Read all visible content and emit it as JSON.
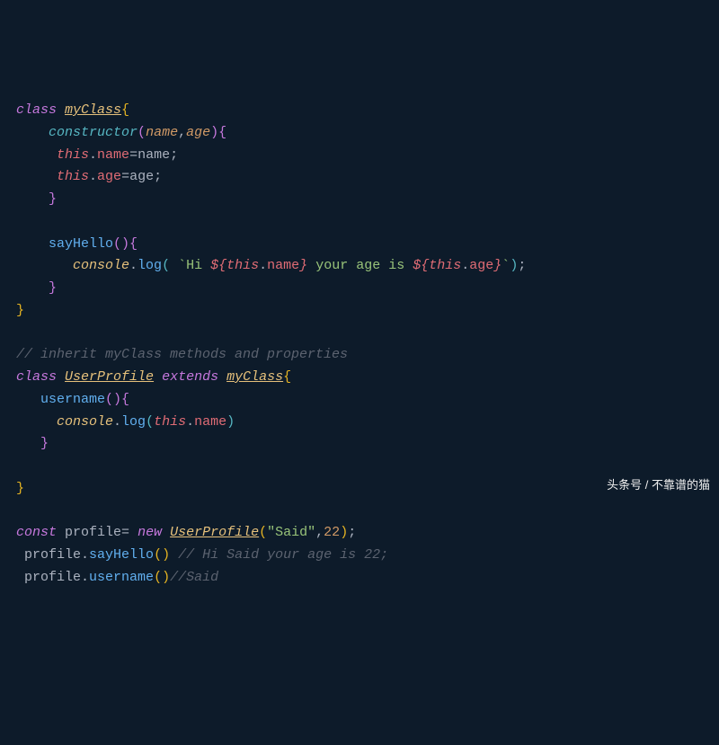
{
  "code": {
    "l1": {
      "class": "class",
      "name": "myClass",
      "ob": "{"
    },
    "l2": {
      "ctor": "constructor",
      "op": "(",
      "p1": "name",
      "c": ",",
      "p2": "age",
      "cp": ")",
      "ob": "{"
    },
    "l3": {
      "this": "this",
      "dot": ".",
      "prop": "name",
      "eq": "=",
      "val": "name",
      "sc": ";"
    },
    "l4": {
      "this": "this",
      "dot": ".",
      "prop": "age",
      "eq": "=",
      "val": "age",
      "sc": ";"
    },
    "l5": {
      "cb": "}"
    },
    "l7": {
      "meth": "sayHello",
      "par": "()",
      "ob": "{"
    },
    "l8": {
      "cons": "console",
      "dot": ".",
      "log": "log",
      "op": "(",
      "sp": " ",
      "bt1": "`Hi ",
      "d1": "${",
      "this1": "this",
      "dot1": ".",
      "prop1": "name",
      "cb1": "}",
      "mid": " your age is ",
      "d2": "${",
      "this2": "this",
      "dot2": ".",
      "prop2": "age",
      "cb2": "}",
      "bt2": "`",
      "cp": ")",
      "sc": ";"
    },
    "l9": {
      "cb": "}"
    },
    "l10": {
      "cb": "}"
    },
    "l12": {
      "cmt": "// inherit myClass methods and properties"
    },
    "l13": {
      "class": "class",
      "name": "UserProfile",
      "ext": "extends",
      "sup": "myClass",
      "ob": "{"
    },
    "l14": {
      "meth": "username",
      "par": "()",
      "ob": "{"
    },
    "l15": {
      "cons": "console",
      "dot": ".",
      "log": "log",
      "op": "(",
      "this": "this",
      "dot2": ".",
      "prop": "name",
      "cp": ")"
    },
    "l16": {
      "cb": "}"
    },
    "l18": {
      "cb": "}"
    },
    "l20": {
      "const": "const",
      "var": "profile",
      "eq": "= ",
      "new": "new",
      "cls": "UserProfile",
      "op": "(",
      "str": "\"Said\"",
      "c": ",",
      "num": "22",
      "cp": ")",
      "sc": ";"
    },
    "l21": {
      "var": "profile",
      "dot": ".",
      "meth": "sayHello",
      "par": "()",
      "cmt": " // Hi Said your age is 22;"
    },
    "l22": {
      "var": "profile",
      "dot": ".",
      "meth": "username",
      "par": "()",
      "cmt": "//Said"
    }
  },
  "watermark": "头条号 / 不靠谱的猫"
}
